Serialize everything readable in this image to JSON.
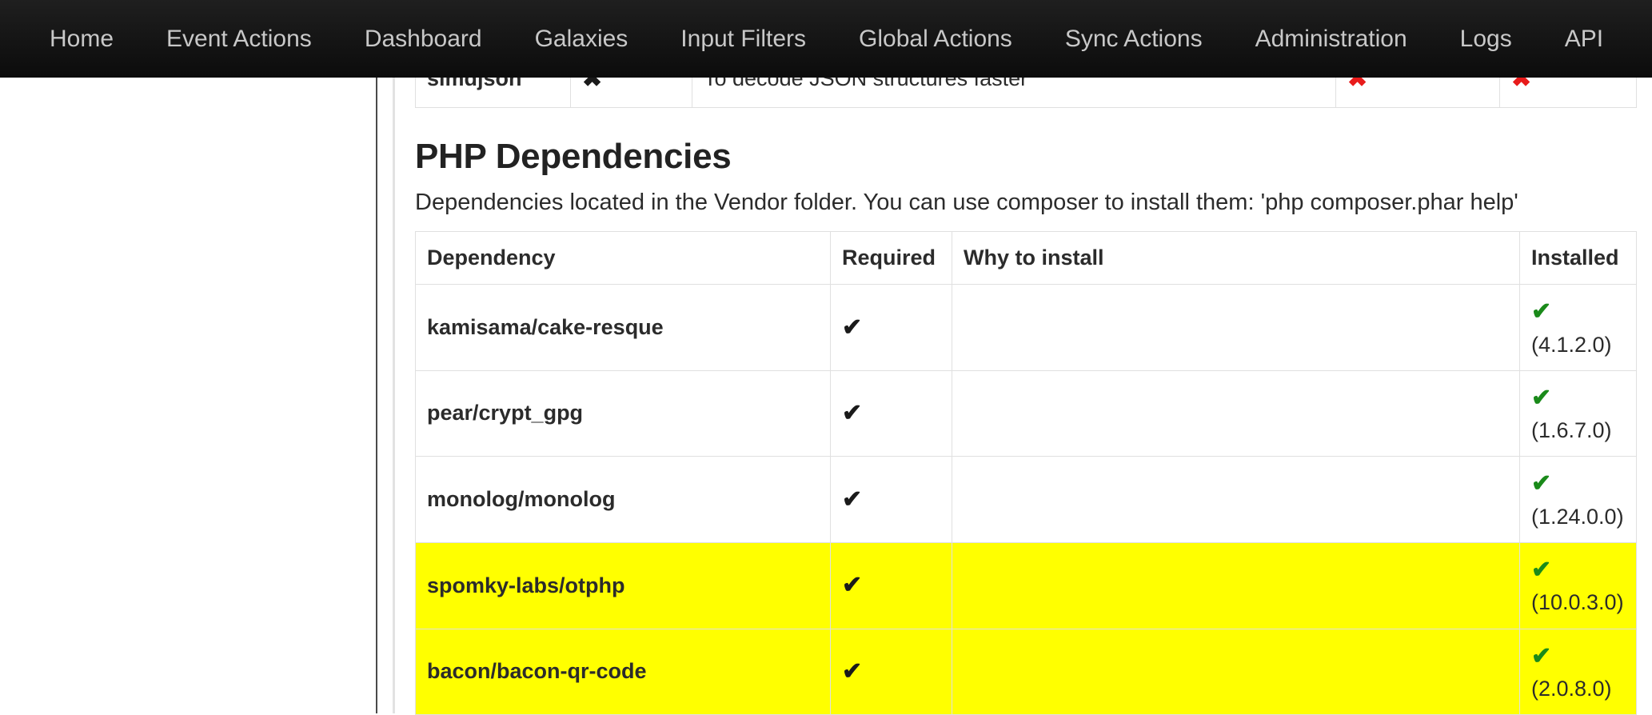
{
  "nav": {
    "items": [
      {
        "label": "Home",
        "name": "nav-item-home"
      },
      {
        "label": "Event Actions",
        "name": "nav-item-event-actions"
      },
      {
        "label": "Dashboard",
        "name": "nav-item-dashboard"
      },
      {
        "label": "Galaxies",
        "name": "nav-item-galaxies"
      },
      {
        "label": "Input Filters",
        "name": "nav-item-input-filters"
      },
      {
        "label": "Global Actions",
        "name": "nav-item-global-actions"
      },
      {
        "label": "Sync Actions",
        "name": "nav-item-sync-actions"
      },
      {
        "label": "Administration",
        "name": "nav-item-administration"
      },
      {
        "label": "Logs",
        "name": "nav-item-logs"
      },
      {
        "label": "API",
        "name": "nav-item-api"
      }
    ]
  },
  "top_table": {
    "rows": [
      {
        "name": "simdjson",
        "required": "✖",
        "required_kind": "x-black",
        "why": "To decode JSON structures faster",
        "col4": "✖",
        "col4_kind": "x-red",
        "col5": "✖",
        "col5_kind": "x-red"
      }
    ]
  },
  "php_dependencies": {
    "title": "PHP Dependencies",
    "description": "Dependencies located in the Vendor folder. You can use composer to install them: 'php composer.phar help'",
    "columns": [
      "Dependency",
      "Required",
      "Why to install",
      "Installed"
    ],
    "rows": [
      {
        "dependency": "kamisama/cake-resque",
        "required": "✔",
        "why": "",
        "installed_mark": "✔",
        "installed_version": "(4.1.2.0)",
        "highlight": false,
        "wrap_version": false
      },
      {
        "dependency": "pear/crypt_gpg",
        "required": "✔",
        "why": "",
        "installed_mark": "✔",
        "installed_version": "(1.6.7.0)",
        "highlight": false,
        "wrap_version": false
      },
      {
        "dependency": "monolog/monolog",
        "required": "✔",
        "why": "",
        "installed_mark": "✔",
        "installed_version": "(1.24.0.0)",
        "highlight": false,
        "wrap_version": true
      },
      {
        "dependency": "spomky-labs/otphp",
        "required": "✔",
        "why": "",
        "installed_mark": "✔",
        "installed_version": "(10.0.3.0)",
        "highlight": true,
        "wrap_version": true
      },
      {
        "dependency": "bacon/bacon-qr-code",
        "required": "✔",
        "why": "",
        "installed_mark": "✔",
        "installed_version": "(2.0.8.0)",
        "highlight": true,
        "wrap_version": false
      }
    ]
  },
  "colors": {
    "navbar_bg": "#141414",
    "nav_text": "#c8c8c8",
    "highlight": "#ffff00",
    "check_green": "#1a8a1a",
    "x_red": "#e81b1b",
    "border": "#e0e0e0"
  }
}
